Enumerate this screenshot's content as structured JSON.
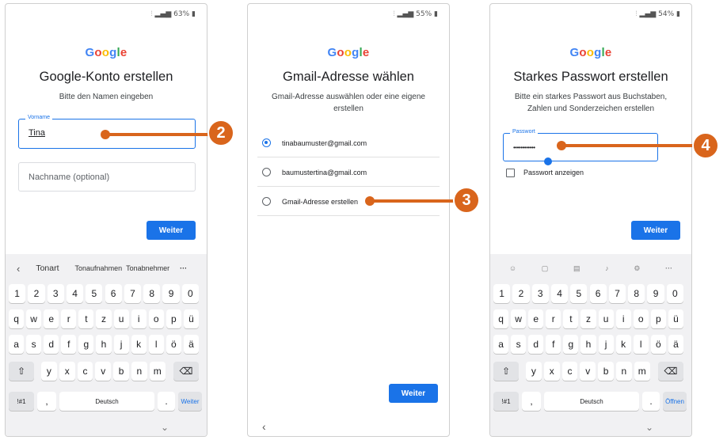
{
  "screen1": {
    "status": "63%",
    "logo": "Google",
    "title": "Google-Konto erstellen",
    "subtitle": "Bitte den Namen eingeben",
    "vorname_label": "Vorname",
    "vorname_value": "Tina",
    "nachname_placeholder": "Nachname (optional)",
    "next_label": "Weiter",
    "suggestions": [
      "Tonart",
      "Tonaufnahmen",
      "Tonabnehmer"
    ],
    "space_label": "Deutsch",
    "enter_label": "Weiter",
    "callout": "2"
  },
  "screen2": {
    "status": "55%",
    "logo": "Google",
    "title": "Gmail-Adresse wählen",
    "subtitle": "Gmail-Adresse auswählen oder eine eigene erstellen",
    "options": [
      {
        "label": "tinabaumuster@gmail.com",
        "selected": true
      },
      {
        "label": "baumustertina@gmail.com",
        "selected": false
      },
      {
        "label": "Gmail-Adresse erstellen",
        "selected": false
      }
    ],
    "next_label": "Weiter",
    "callout": "3"
  },
  "screen3": {
    "status": "54%",
    "logo": "Google",
    "title": "Starkes Passwort erstellen",
    "subtitle": "Bitte ein starkes Passwort aus Buchstaben, Zahlen und Sonderzeichen erstellen",
    "password_label": "Passwort",
    "password_value": "••••••••••••",
    "show_password": "Passwort anzeigen",
    "next_label": "Weiter",
    "space_label": "Deutsch",
    "enter_label": "Öffnen",
    "callout": "4"
  },
  "keyboard": {
    "row_numbers": [
      "1",
      "2",
      "3",
      "4",
      "5",
      "6",
      "7",
      "8",
      "9",
      "0"
    ],
    "row1": [
      "q",
      "w",
      "e",
      "r",
      "t",
      "z",
      "u",
      "i",
      "o",
      "p",
      "ü"
    ],
    "row2": [
      "a",
      "s",
      "d",
      "f",
      "g",
      "h",
      "j",
      "k",
      "l",
      "ö",
      "ä"
    ],
    "row3": [
      "y",
      "x",
      "c",
      "v",
      "b",
      "n",
      "m"
    ],
    "symbols_label": "!#1",
    "comma": ",",
    "period": "."
  },
  "icons": {
    "shift": "shift-icon",
    "backspace": "backspace-icon",
    "back": "back-chevron-icon",
    "hide_kbd": "chevron-down-icon",
    "more": "more-icon"
  },
  "colors": {
    "accent": "#1a73e8",
    "callout": "#d9651c"
  }
}
